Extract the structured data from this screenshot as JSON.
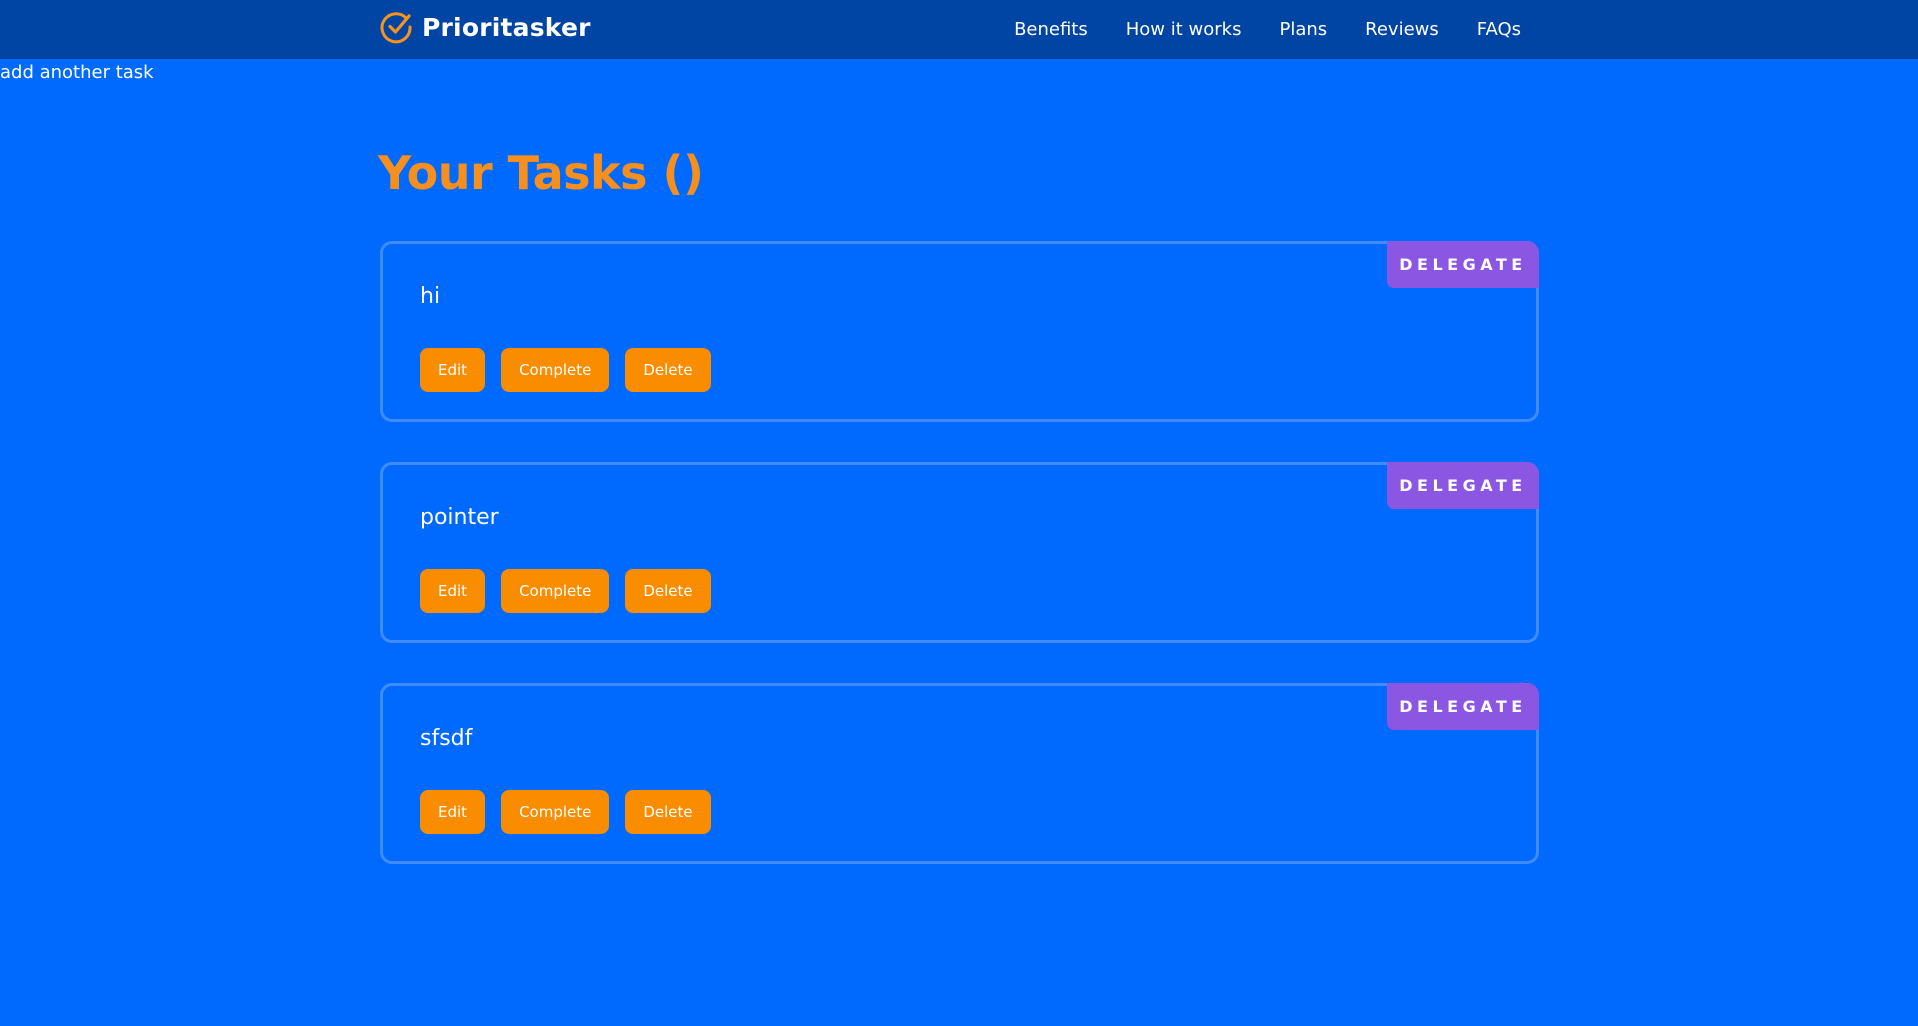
{
  "header": {
    "brand_name": "Prioritasker",
    "brand_icon": "check-circle-icon",
    "nav": [
      {
        "label": "Benefits"
      },
      {
        "label": "How it works"
      },
      {
        "label": "Plans"
      },
      {
        "label": "Reviews"
      },
      {
        "label": "FAQs"
      }
    ]
  },
  "add_task_link": "add another task",
  "page_title": "Your Tasks ()",
  "tasks": [
    {
      "name": "hi",
      "delegate_label": "DELEGATE",
      "edit_label": "Edit",
      "complete_label": "Complete",
      "delete_label": "Delete"
    },
    {
      "name": "pointer",
      "delegate_label": "DELEGATE",
      "edit_label": "Edit",
      "complete_label": "Complete",
      "delete_label": "Delete"
    },
    {
      "name": "sfsdf",
      "delegate_label": "DELEGATE",
      "edit_label": "Edit",
      "complete_label": "Complete",
      "delete_label": "Delete"
    }
  ],
  "colors": {
    "page_background": "#006aff",
    "header_background": "#0044a4",
    "accent_orange": "#f78f1e",
    "button_orange": "#fa8c00",
    "delegate_purple": "#8a56e2",
    "card_border": "#3f8bff"
  }
}
